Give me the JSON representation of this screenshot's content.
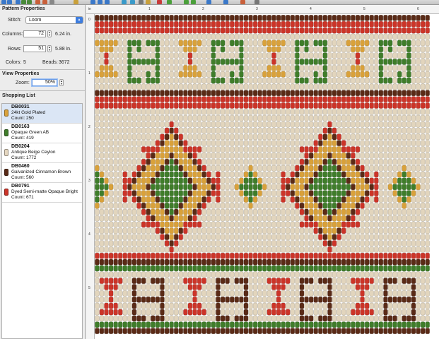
{
  "toolbar": {
    "icons": [
      "new-icon",
      "open-icon",
      "save-icon",
      "undo-icon",
      "redo-icon",
      "cut-icon",
      "copy-icon",
      "paste-icon",
      "pencil-icon",
      "fill-icon",
      "select-icon",
      "color-icon",
      "rotate-icon",
      "flip-icon",
      "text-icon",
      "export-icon",
      "print-icon",
      "zoom-in-icon",
      "zoom-out-icon",
      "grid-icon",
      "move-up-icon",
      "move-down-icon",
      "trim-icon",
      "settings-icon"
    ]
  },
  "pattern_properties": {
    "title": "Pattern Properties",
    "stitch_label": "Stitch:",
    "stitch_value": "Loom",
    "columns_label": "Columns:",
    "columns_value": "72",
    "columns_inches": "6.24 in.",
    "rows_label": "Rows:",
    "rows_value": "51",
    "rows_inches": "5.88 in.",
    "colors_label": "Colors:",
    "colors_value": "5",
    "beads_label": "Beads:",
    "beads_value": "3672"
  },
  "view_properties": {
    "title": "View Properties",
    "zoom_label": "Zoom:",
    "zoom_value": "50%"
  },
  "shopping_list": {
    "title": "Shopping List",
    "items": [
      {
        "code": "DB0031",
        "name": "24kt Gold Plated",
        "count": "Count: 250",
        "color": "#d9a13a",
        "selected": true
      },
      {
        "code": "DB0163",
        "name": "Opaque Green AB",
        "count": "Count: 419",
        "color": "#3f7d2a",
        "selected": false
      },
      {
        "code": "DB0204",
        "name": "Antique Beige Ceylon",
        "count": "Count: 1772",
        "color": "#e4d6bf",
        "selected": false
      },
      {
        "code": "DB0460",
        "name": "Galvanized Cinnamon Brown",
        "count": "Count: 560",
        "color": "#5a2a16",
        "selected": false
      },
      {
        "code": "DB0791",
        "name": "Dyed Semi-matte Opaque Bright",
        "count": "Count: 671",
        "color": "#cc3428",
        "selected": false
      }
    ]
  },
  "rulers": {
    "top": [
      "in",
      "1",
      "2",
      "3",
      "4",
      "5",
      "6"
    ],
    "left": [
      "0",
      "1",
      "2",
      "3",
      "4",
      "5"
    ]
  },
  "bead_colors": {
    "beige": "#e2d5bd",
    "gold": "#d9a13a",
    "green": "#3f7d2a",
    "brown": "#5a2a16",
    "red": "#cc3428"
  }
}
